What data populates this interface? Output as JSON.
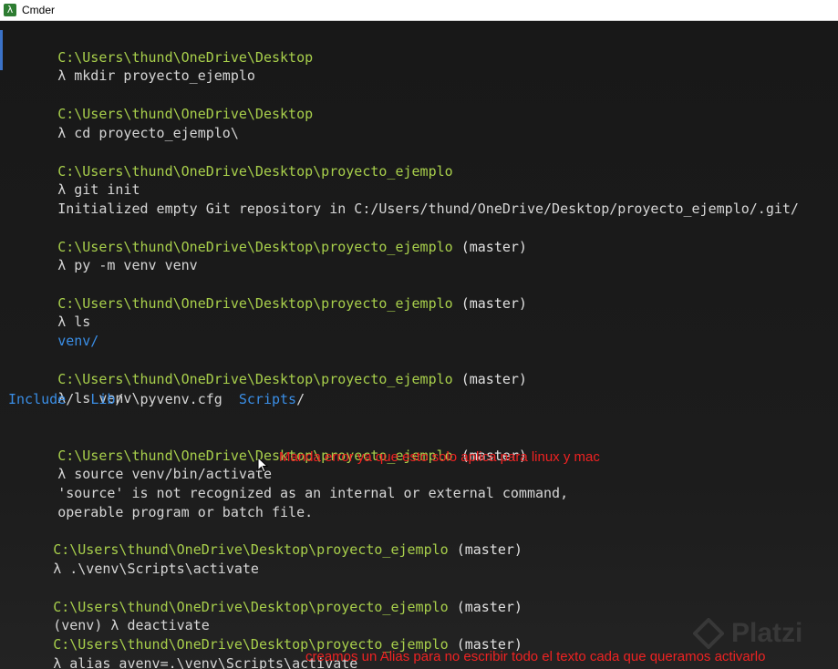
{
  "window": {
    "title": "Cmder",
    "app_icon": "λ"
  },
  "colors": {
    "path": "#a8cf4b",
    "directory": "#3a8ee6",
    "text": "#d6d6d6",
    "annotation": "#ee2222"
  },
  "terminal": {
    "p1": "C:\\Users\\thund\\OneDrive\\Desktop",
    "c1": "λ mkdir proyecto_ejemplo",
    "p2": "C:\\Users\\thund\\OneDrive\\Desktop",
    "c2": "λ cd proyecto_ejemplo\\",
    "p3": "C:\\Users\\thund\\OneDrive\\Desktop\\proyecto_ejemplo",
    "c3": "λ git init",
    "o3": "Initialized empty Git repository in C:/Users/thund/OneDrive/Desktop/proyecto_ejemplo/.git/",
    "p4": "C:\\Users\\thund\\OneDrive\\Desktop\\proyecto_ejemplo",
    "b4": " (master)",
    "c4": "λ py -m venv venv",
    "p5": "C:\\Users\\thund\\OneDrive\\Desktop\\proyecto_ejemplo",
    "b5": " (master)",
    "c5": "λ ls",
    "o5": "venv/",
    "p6": "C:\\Users\\thund\\OneDrive\\Desktop\\proyecto_ejemplo",
    "b6": " (master)",
    "c6": "λ ls venv\\",
    "o6_include": "Include",
    "o6_include_slash": "/  ",
    "o6_lib": "Lib",
    "o6_lib_slash": "/  ",
    "o6_cfg": "pyvenv.cfg  ",
    "o6_scripts": "Scripts",
    "o6_scripts_slash": "/",
    "p7": "C:\\Users\\thund\\OneDrive\\Desktop\\proyecto_ejemplo",
    "b7": " (master)",
    "c7": "λ source venv/bin/activate",
    "o7a": "'source' is not recognized as an internal or external command,",
    "o7b": "operable program or batch file.",
    "p8": "C:\\Users\\thund\\OneDrive\\Desktop\\proyecto_ejemplo",
    "b8": " (master)",
    "c8": "λ .\\venv\\Scripts\\activate",
    "p9": "C:\\Users\\thund\\OneDrive\\Desktop\\proyecto_ejemplo",
    "b9": " (master)",
    "c9": "(venv) λ deactivate",
    "p10": "C:\\Users\\thund\\OneDrive\\Desktop\\proyecto_ejemplo",
    "b10": " (master)",
    "c10": "λ alias avenv=.\\venv\\Scripts\\activate"
  },
  "annotations": {
    "source_error": "Manda error ya que esto solo aplica para linux y mac",
    "alias_note": "creamos un Alias para no escribir todo el texto cada que queramos activarlo"
  },
  "watermark": {
    "text": "Platzi"
  }
}
